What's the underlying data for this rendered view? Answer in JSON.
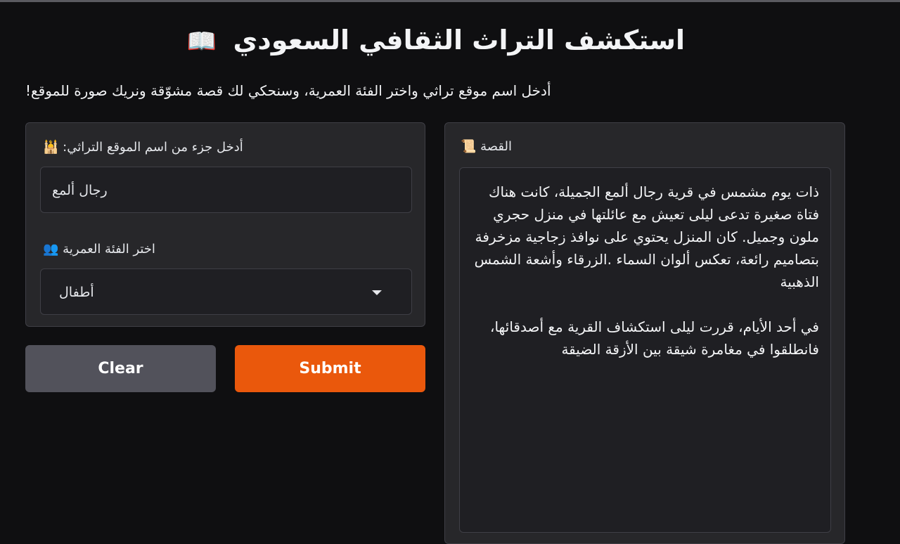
{
  "header": {
    "title": "استكشف التراث الثقافي السعودي",
    "title_icon": "📖",
    "description": "!أدخل اسم موقع تراثي واختر الفئة العمرية، وسنحكي لك قصة مشوّقة ونريك صورة للموقع"
  },
  "form": {
    "site_label": ":أدخل جزء من اسم الموقع التراثي",
    "site_label_icon": "🕌",
    "site_value": "رجال ألمع",
    "age_label": "اختر الفئة العمرية",
    "age_label_icon": "👥",
    "age_selected": "أطفال"
  },
  "buttons": {
    "clear": "Clear",
    "submit": "Submit"
  },
  "story": {
    "label": "القصة",
    "label_icon": "📜",
    "text": "ذات يوم مشمس في قرية رجال ألمع الجميلة، كانت هناك فتاة صغيرة تدعى ليلى تعيش مع عائلتها في منزل حجري ملون وجميل. كان المنزل يحتوي على نوافذ زجاجية مزخرفة بتصاميم رائعة، تعكس ألوان السماء .الزرقاء وأشعة الشمس الذهبية\n\nفي أحد الأيام، قررت ليلى استكشاف القرية مع أصدقائها، فانطلقوا في مغامرة شيقة بين الأزقة الضيقة"
  },
  "colors": {
    "background": "#0f0f11",
    "panel": "#27272a",
    "field": "#1f1f23",
    "submit": "#ea580c",
    "clear": "#52525b"
  }
}
